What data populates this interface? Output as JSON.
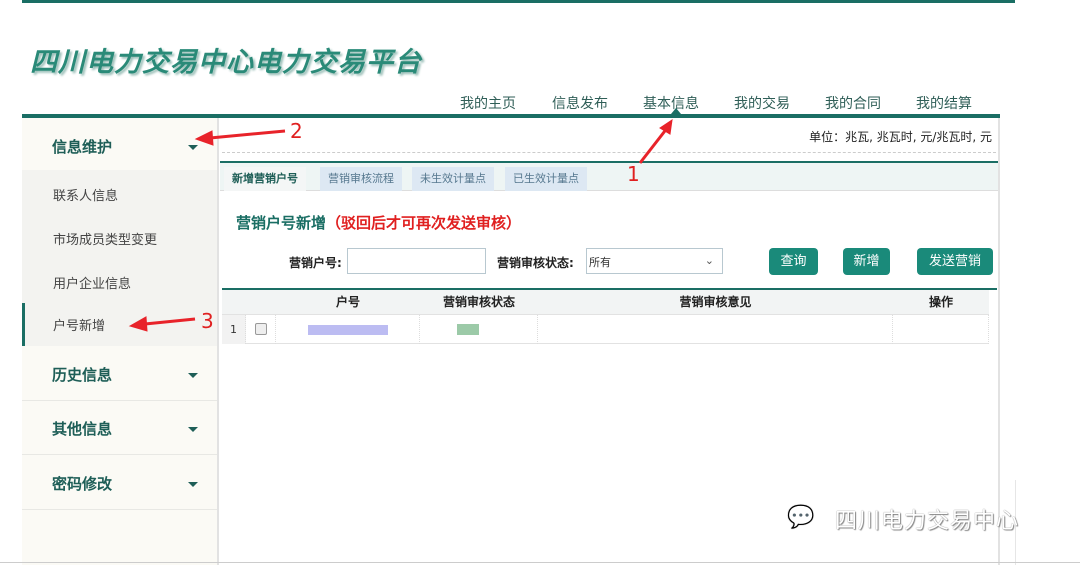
{
  "app_title": "四川电力交易中心电力交易平台",
  "nav": [
    "我的主页",
    "信息发布",
    "基本信息",
    "我的交易",
    "我的合同",
    "我的结算"
  ],
  "unit_text": "单位：兆瓦, 兆瓦时, 元/兆瓦时, 元",
  "sidebar": {
    "sections": [
      {
        "label": "信息维护",
        "items": [
          "联系人信息",
          "市场成员类型变更",
          "用户企业信息",
          "户号新增"
        ],
        "active_item": "户号新增"
      },
      {
        "label": "历史信息"
      },
      {
        "label": "其他信息"
      },
      {
        "label": "密码修改"
      }
    ]
  },
  "tabs": [
    "新增营销户号",
    "营销审核流程",
    "未生效计量点",
    "已生效计量点"
  ],
  "heading": {
    "title": "营销户号新增",
    "note": "（驳回后才可再次发送审核）"
  },
  "form": {
    "account_label": "营销户号:",
    "account_value": "",
    "status_label": "营销审核状态:",
    "status_value": "所有"
  },
  "buttons": {
    "query": "查询",
    "add": "新增",
    "send": "发送营销"
  },
  "table": {
    "headers": [
      "户号",
      "营销审核状态",
      "营销审核意见",
      "操作"
    ],
    "rows": [
      {
        "index": "1",
        "account": "",
        "status": "",
        "opinion": "",
        "action": ""
      }
    ]
  },
  "annotations": [
    "1",
    "2",
    "3"
  ],
  "watermark": "四川电力交易中心",
  "colors": {
    "primary": "#1a6e64",
    "button": "#1a8a7a",
    "alert": "#e02020"
  }
}
